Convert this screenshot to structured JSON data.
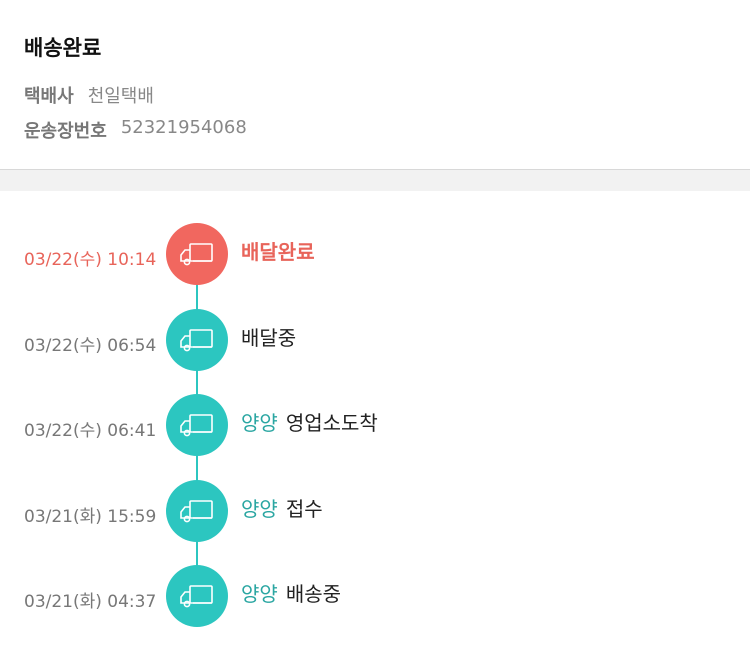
{
  "header": {
    "title": "배송완료",
    "courier_label": "택배사",
    "courier_value": "천일택배",
    "tracking_label": "운송장번호",
    "tracking_value": "52321954068"
  },
  "colors": {
    "active": "#f1675f",
    "normal": "#2cc6c0",
    "location_text": "#2aa6a2"
  },
  "timeline": [
    {
      "time": "03/22(수) 10:14",
      "location": "",
      "status": "배달완료",
      "icon": "truck-icon",
      "active": true
    },
    {
      "time": "03/22(수) 06:54",
      "location": "",
      "status": "배달중",
      "icon": "truck-icon",
      "active": false
    },
    {
      "time": "03/22(수) 06:41",
      "location": "양양",
      "status": "영업소도착",
      "icon": "truck-icon",
      "active": false
    },
    {
      "time": "03/21(화) 15:59",
      "location": "양양",
      "status": "접수",
      "icon": "truck-icon",
      "active": false
    },
    {
      "time": "03/21(화) 04:37",
      "location": "양양",
      "status": "배송중",
      "icon": "truck-icon",
      "active": false
    }
  ]
}
